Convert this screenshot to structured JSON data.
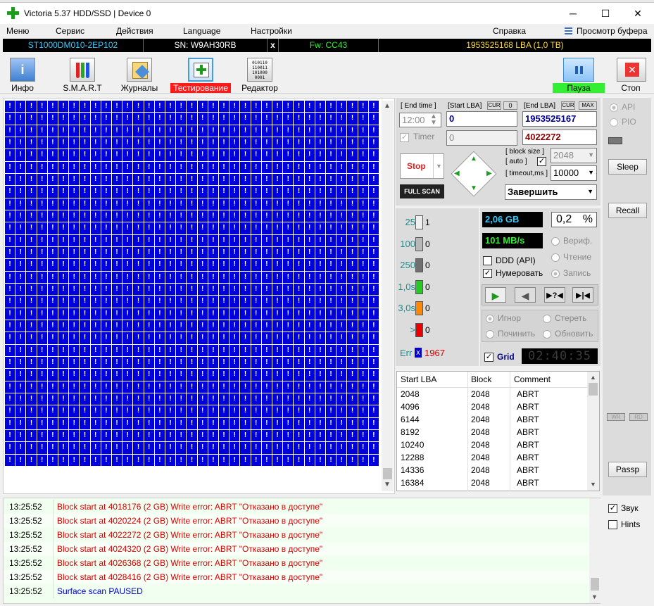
{
  "window": {
    "title": "Victoria 5.37 HDD/SSD | Device 0"
  },
  "menu": [
    "Меню",
    "Сервис",
    "Действия",
    "Language",
    "Настройки",
    "Справка"
  ],
  "menu_buffer": "Просмотр буфера",
  "device": {
    "model": "ST1000DM010-2EP102",
    "serial": "SN: W9AH30RB",
    "close": "x",
    "fw": "Fw: CC43",
    "capacity": "1953525168 LBA (1,0 TB)"
  },
  "toolbar": {
    "info": "Инфо",
    "smart": "S.M.A.R.T",
    "journals": "Журналы",
    "testing": "Тестирование",
    "editor": "Редактор",
    "pause": "Пауза",
    "stop": "Стоп"
  },
  "grid": {
    "symbol": "!",
    "cols": 35,
    "rows": 30
  },
  "controls": {
    "end_time_label": "[ End time ]",
    "end_time_value": "12:00",
    "timer_label": "Timer",
    "timer_value": "0",
    "start_lba_label": "[Start LBA]",
    "cur_label": "CUR",
    "cur_value": "0",
    "end_lba_label": "[End LBA]",
    "max_label": "MAX",
    "start_lba_value": "0",
    "end_lba_value": "1953525167",
    "current_lba": "4022272",
    "stop_btn": "Stop",
    "full_scan": "FULL SCAN",
    "block_size_label": "[ block size ]",
    "auto_label": "[ auto ]",
    "block_size_value": "2048",
    "timeout_label": "[ timeout,ms ]",
    "timeout_value": "10000",
    "finish_label": "Завершить"
  },
  "legend": [
    {
      "label": "25",
      "count": "1",
      "color": "#f0f0f0"
    },
    {
      "label": "100",
      "count": "0",
      "color": "#b8b8b8"
    },
    {
      "label": "250",
      "count": "0",
      "color": "#707070"
    },
    {
      "label": "1,0s",
      "count": "0",
      "color": "#22cc22"
    },
    {
      "label": "3,0s",
      "count": "0",
      "color": "#ff8800"
    },
    {
      "label": ">",
      "count": "0",
      "color": "#ee0000"
    }
  ],
  "err": {
    "label": "Err",
    "mark": "x",
    "count": "1967"
  },
  "stats": {
    "size": "2,06 GB",
    "percent": "0,2",
    "percent_sign": "%",
    "speed": "101 MB/s"
  },
  "options": {
    "verify": "Вериф.",
    "read": "Чтение",
    "write": "Запись",
    "ddd": "DDD (API)",
    "number": "Нумеровать"
  },
  "actions": {
    "ignore": "Игнор",
    "erase": "Стереть",
    "repair": "Починить",
    "refresh": "Обновить"
  },
  "grid_toggle": "Grid",
  "timer_display": "02:40:35",
  "right_side": {
    "api": "API",
    "pio": "PIO",
    "sleep": "Sleep",
    "recall": "Recall",
    "wr": "WR",
    "rd": "RD",
    "passp": "Passp",
    "sound": "Звук",
    "hints": "Hints"
  },
  "table": {
    "headers": [
      "Start LBA",
      "Block",
      "Comment"
    ],
    "rows": [
      [
        "2048",
        "2048",
        "ABRT"
      ],
      [
        "4096",
        "2048",
        "ABRT"
      ],
      [
        "6144",
        "2048",
        "ABRT"
      ],
      [
        "8192",
        "2048",
        "ABRT"
      ],
      [
        "10240",
        "2048",
        "ABRT"
      ],
      [
        "12288",
        "2048",
        "ABRT"
      ],
      [
        "14336",
        "2048",
        "ABRT"
      ],
      [
        "16384",
        "2048",
        "ABRT"
      ]
    ]
  },
  "log": [
    {
      "time": "13:25:52",
      "msg": "Block start at 4018176 (2 GB) Write error: ABRT \"Отказано в доступе\"",
      "color": "#dd0000"
    },
    {
      "time": "13:25:52",
      "msg": "Block start at 4020224 (2 GB) Write error: ABRT \"Отказано в доступе\"",
      "color": "#dd0000"
    },
    {
      "time": "13:25:52",
      "msg": "Block start at 4022272 (2 GB) Write error: ABRT \"Отказано в доступе\"",
      "color": "#dd0000"
    },
    {
      "time": "13:25:52",
      "msg": "Block start at 4024320 (2 GB) Write error: ABRT \"Отказано в доступе\"",
      "color": "#dd0000"
    },
    {
      "time": "13:25:52",
      "msg": "Block start at 4026368 (2 GB) Write error: ABRT \"Отказано в доступе\"",
      "color": "#dd0000"
    },
    {
      "time": "13:25:52",
      "msg": "Block start at 4028416 (2 GB) Write error: ABRT \"Отказано в доступе\"",
      "color": "#dd0000"
    },
    {
      "time": "13:25:52",
      "msg": "Surface scan PAUSED",
      "color": "#0000cc"
    }
  ]
}
